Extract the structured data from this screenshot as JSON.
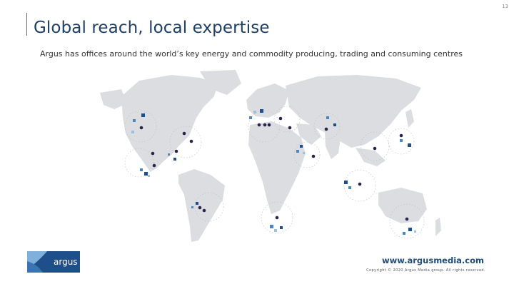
{
  "slide": {
    "number": "13",
    "title": "Global reach, local expertise",
    "subtitle": "Argus has offices around the world’s key energy and commodity producing, trading and consuming centres"
  },
  "map": {
    "colors": {
      "land": "#dcdde0",
      "office_dot": "#2a2350",
      "square_dark": "#1f4f8b",
      "square_mid": "#4b86c1",
      "square_light": "#9dc0e0",
      "ring": "#b8bdc4"
    }
  },
  "footer": {
    "logo_text": "argus",
    "website": "www.argusmedia.com",
    "copyright": "Copyright © 2020 Argus Media group. All rights reserved."
  }
}
